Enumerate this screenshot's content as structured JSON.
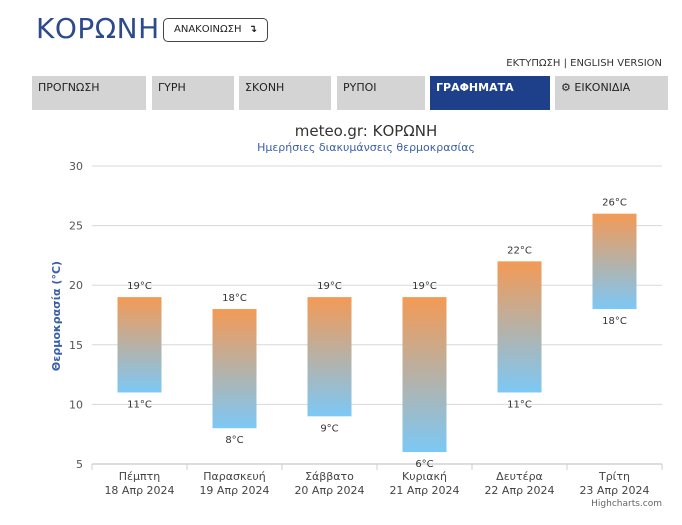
{
  "header": {
    "title": "ΚΟΡΩΝΗ",
    "announce_label": "ΑΝΑΚΟΙΝΩΣΗ",
    "announce_icon": "arrow-down-right-icon",
    "print_link": "ΕΚΤΥΠΩΣΗ",
    "separator": "|",
    "english_link": "ENGLISH VERSION"
  },
  "nav": {
    "tabs": [
      {
        "label": "ΠΡΟΓΝΩΣΗ",
        "active": false
      },
      {
        "label": "ΓΥΡΗ",
        "active": false
      },
      {
        "label": "ΣΚΟΝΗ",
        "active": false
      },
      {
        "label": "ΡΥΠΟΙ",
        "active": false
      },
      {
        "label": "ΓΡΑΦΗΜΑΤΑ",
        "active": true
      },
      {
        "label": "ΕΙΚΟΝΙΔΙΑ",
        "active": false,
        "icon": "gear-icon"
      }
    ]
  },
  "chart_data": {
    "type": "bar",
    "subtype": "columnrange",
    "title": "meteo.gr: ΚΟΡΩΝΗ",
    "subtitle": "Ημερήσιες διακυμάνσεις θερμοκρασίας",
    "ylabel": "Θερμοκρασία (°C)",
    "ylim": [
      5,
      30
    ],
    "yticks": [
      "5",
      "10",
      "15",
      "20",
      "25",
      "30"
    ],
    "grid": true,
    "categories": [
      {
        "day": "Πέμπτη",
        "date": "18 Απρ 2024"
      },
      {
        "day": "Παρασκευή",
        "date": "19 Απρ 2024"
      },
      {
        "day": "Σάββατο",
        "date": "20 Απρ 2024"
      },
      {
        "day": "Κυριακή",
        "date": "21 Απρ 2024"
      },
      {
        "day": "Δευτέρα",
        "date": "22 Απρ 2024"
      },
      {
        "day": "Τρίτη",
        "date": "23 Απρ 2024"
      }
    ],
    "low": [
      11,
      8,
      9,
      6,
      11,
      18
    ],
    "high": [
      19,
      18,
      19,
      19,
      22,
      26
    ],
    "low_labels": [
      "11°C",
      "8°C",
      "9°C",
      "6°C",
      "11°C",
      "18°C"
    ],
    "high_labels": [
      "19°C",
      "18°C",
      "19°C",
      "19°C",
      "22°C",
      "26°C"
    ],
    "colors": {
      "top": "#f39a55",
      "bottom": "#7cc8f5",
      "grid": "#d8d8d8",
      "title": "#333333",
      "subtitle": "#3a5fa8",
      "axis_title": "#3a5fa8"
    },
    "credits": "Highcharts.com"
  }
}
